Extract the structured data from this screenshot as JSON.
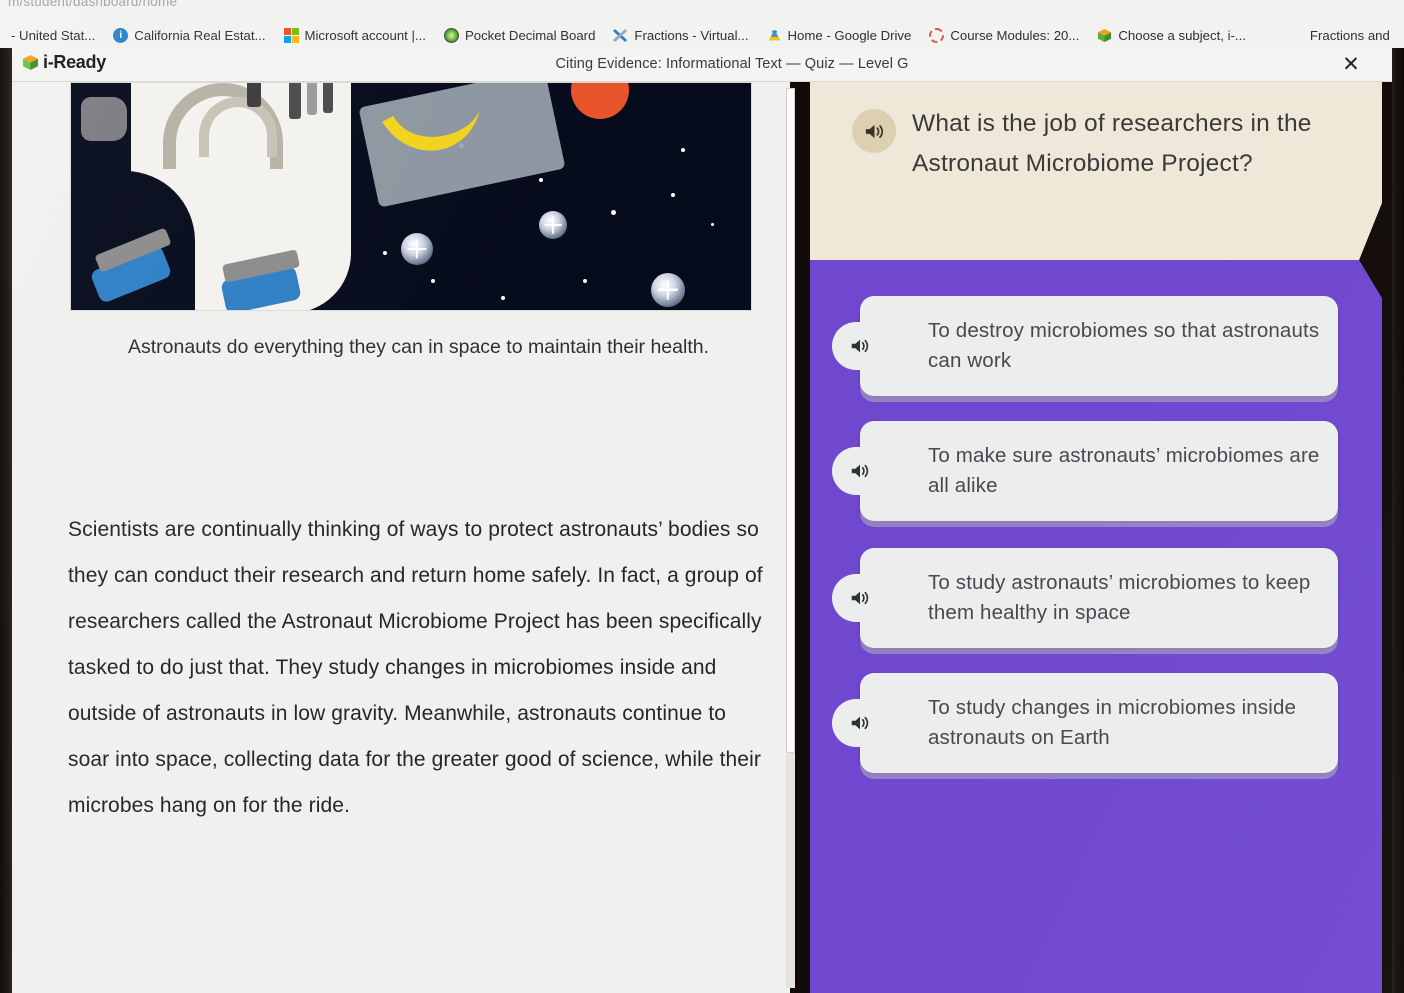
{
  "browser": {
    "url_fragment": "m/student/dashboard/home",
    "bookmarks": [
      {
        "label": "- United Stat...",
        "icon": "none-icon"
      },
      {
        "label": "California Real Estat...",
        "icon": "info-circle-icon"
      },
      {
        "label": "Microsoft account |...",
        "icon": "microsoft-logo-icon"
      },
      {
        "label": "Pocket Decimal Board",
        "icon": "green-seal-icon"
      },
      {
        "label": "Fractions - Virtual...",
        "icon": "blue-cross-tool-icon"
      },
      {
        "label": "Home - Google Drive",
        "icon": "google-drive-icon"
      },
      {
        "label": "Course Modules: 20...",
        "icon": "dashed-circle-icon"
      },
      {
        "label": "Choose a subject, i-...",
        "icon": "iready-cube-icon"
      },
      {
        "label": "Fractions and",
        "icon": "none-icon"
      }
    ]
  },
  "app": {
    "brand": "i-Ready",
    "quiz_title": "Citing Evidence: Informational Text — Quiz — Level G",
    "close_label": "✕",
    "accent_purple": "#7048d0",
    "question_card_bg": "#efe8d8",
    "choice_bg": "#eceded"
  },
  "reading": {
    "image_alt": "Astronaut floating in space beside a banana in a pouch, with stars and a red sun",
    "caption": "Astronauts do everything they can in space to maintain their health.",
    "paragraph": "Scientists are continually thinking of ways to protect astronauts’ bodies so they can conduct their research and return home safely. In fact, a group of researchers called the Astronaut Microbiome Project has been specifically tasked to do just that. They study changes in microbiomes inside and outside of astronauts in low gravity. Meanwhile, astronauts continue to soar into space, collecting data for the greater good of science, while their microbes hang on for the ride."
  },
  "quiz": {
    "question": "What is the job of researchers in the Astronaut Microbiome Project?",
    "question_audio_label": "speaker-icon",
    "choices": [
      {
        "text": "To destroy microbiomes so that astronauts can work",
        "selected": false
      },
      {
        "text": "To make sure astronauts’ microbiomes are all alike",
        "selected": false
      },
      {
        "text": "To study astronauts’ microbiomes to keep them healthy in space",
        "selected": false
      },
      {
        "text": "To study changes in microbiomes inside astronauts on Earth",
        "selected": false
      }
    ]
  }
}
